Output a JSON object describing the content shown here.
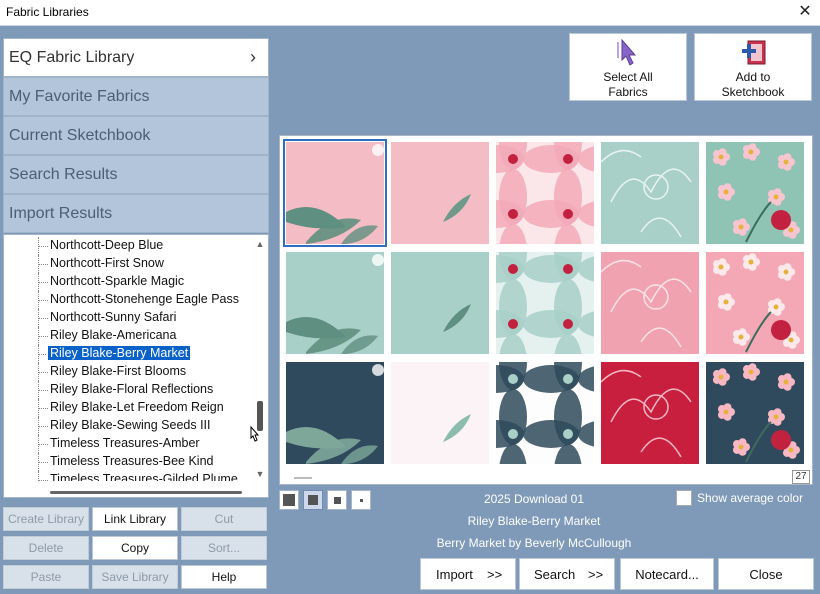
{
  "window": {
    "title": "Fabric Libraries"
  },
  "nav": [
    {
      "label": "EQ Fabric Library",
      "active": true
    },
    {
      "label": "My Favorite Fabrics"
    },
    {
      "label": "Current Sketchbook"
    },
    {
      "label": "Search Results"
    },
    {
      "label": "Import Results"
    }
  ],
  "tree": [
    "Northcott-Deep Blue",
    "Northcott-First Snow",
    "Northcott-Sparkle Magic",
    "Northcott-Stonehenge Eagle Pass",
    "Northcott-Sunny Safari",
    "Riley Blake-Americana",
    "Riley Blake-Berry Market",
    "Riley Blake-First Blooms",
    "Riley Blake-Floral Reflections",
    "Riley Blake-Let Freedom Reign",
    "Riley Blake-Sewing Seeds III",
    "Timeless Treasures-Amber",
    "Timeless Treasures-Bee Kind",
    "Timeless Treasures-Gilded Plume"
  ],
  "tree_selected": "Riley Blake-Berry Market",
  "library_buttons": {
    "create": "Create Library",
    "link": "Link Library",
    "cut": "Cut",
    "delete": "Delete",
    "copy": "Copy",
    "sort": "Sort...",
    "paste": "Paste",
    "save": "Save Library",
    "help": "Help"
  },
  "top_buttons": {
    "select_all_1": "Select All",
    "select_all_2": "Fabrics",
    "add_1": "Add to",
    "add_2": "Sketchbook"
  },
  "page_count": "27",
  "info": {
    "line1": "2025 Download 01",
    "line2": "Riley Blake-Berry Market",
    "line3": "Berry Market by Beverly McCullough"
  },
  "avg_color_label": "Show average color",
  "bottom_buttons": {
    "import": "Import",
    "import_arrow": ">>",
    "search": "Search",
    "search_arrow": ">>",
    "notecard": "Notecard...",
    "close": "Close"
  },
  "swatches": [
    {
      "kind": "leaf",
      "bg": "#f4bcc4",
      "fg": "#5f8f80"
    },
    {
      "kind": "leafsmall",
      "bg": "#f4bcc4",
      "fg": "#6d9a8b"
    },
    {
      "kind": "petal",
      "bg": "#fbe6ea",
      "fg": "#f2a9b7",
      "accent": "#c2223f"
    },
    {
      "kind": "flowerline",
      "bg": "#a8d0c8",
      "fg": "#e8f3f0"
    },
    {
      "kind": "floral",
      "bg": "#8fc4b4",
      "fg": "#f7c5cf",
      "accent": "#c2223f"
    },
    {
      "kind": "leaf",
      "bg": "#a8d0c8",
      "fg": "#5f8f80"
    },
    {
      "kind": "leafsmall",
      "bg": "#a8d0c8",
      "fg": "#5f8f80"
    },
    {
      "kind": "petal",
      "bg": "#e4f1ee",
      "fg": "#a8d0c8",
      "accent": "#c2223f"
    },
    {
      "kind": "flowerline",
      "bg": "#f1a2b0",
      "fg": "#fde3e8"
    },
    {
      "kind": "floral",
      "bg": "#f4a8b5",
      "fg": "#fde8ec",
      "accent": "#c2223f"
    },
    {
      "kind": "leaf",
      "bg": "#2f4a5c",
      "fg": "#7ea79a"
    },
    {
      "kind": "leafsmall",
      "bg": "#fbf3f5",
      "fg": "#8bbcae"
    },
    {
      "kind": "petal",
      "bg": "#fdfdfd",
      "fg": "#2f4a5c",
      "accent": "#a8d0c8"
    },
    {
      "kind": "flowerline",
      "bg": "#c81f3f",
      "fg": "#f5b7c2"
    },
    {
      "kind": "floral",
      "bg": "#2f4a5c",
      "fg": "#f7b8c4",
      "accent": "#c2223f"
    }
  ]
}
